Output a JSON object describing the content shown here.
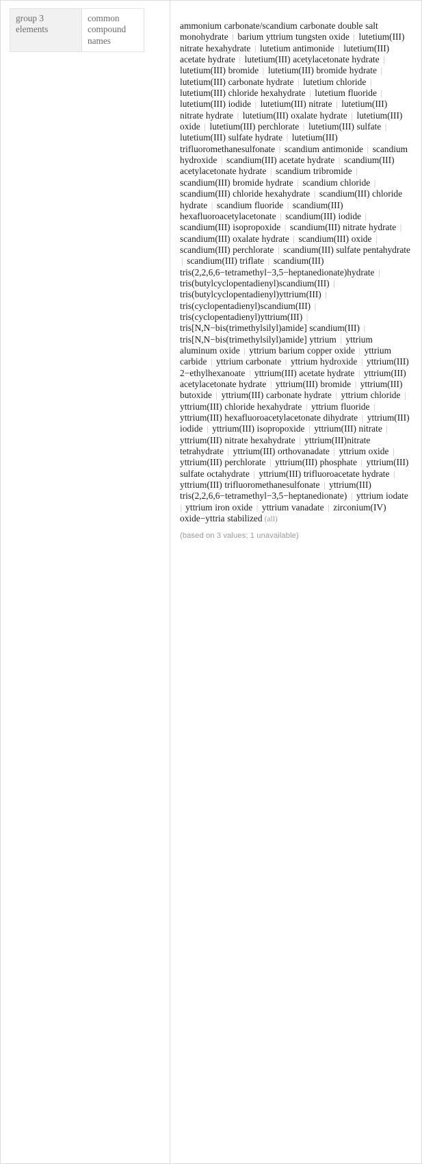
{
  "property_table": {
    "key_label": "group 3 elements",
    "value_label": "common compound names"
  },
  "result": {
    "all_tag": "(all)",
    "basis_note": "(based on 3 values; 1 unavailable)",
    "separator": "|",
    "compounds": [
      "ammonium carbonate/scandium carbonate double salt monohydrate",
      "barium yttrium tungsten oxide",
      "lutetium(III) nitrate hexahydrate",
      "lutetium antimonide",
      "lutetium(III) acetate hydrate",
      "lutetium(III) acetylacetonate hydrate",
      "lutetium(III) bromide",
      "lutetium(III) bromide hydrate",
      "lutetium(III) carbonate hydrate",
      "lutetium chloride",
      "lutetium(III) chloride hexahydrate",
      "lutetium fluoride",
      "lutetium(III) iodide",
      "lutetium(III) nitrate",
      "lutetium(III) nitrate hydrate",
      "lutetium(III) oxalate hydrate",
      "lutetium(III) oxide",
      "lutetium(III) perchlorate",
      "lutetium(III) sulfate",
      "lutetium(III) sulfate hydrate",
      "lutetium(III) trifluoromethanesulfonate",
      "scandium antimonide",
      "scandium hydroxide",
      "scandium(III) acetate hydrate",
      "scandium(III) acetylacetonate hydrate",
      "scandium tribromide",
      "scandium(III) bromide hydrate",
      "scandium chloride",
      "scandium(III) chloride hexahydrate",
      "scandium(III) chloride hydrate",
      "scandium fluoride",
      "scandium(III) hexafluoroacetylacetonate",
      "scandium(III) iodide",
      "scandium(III) isopropoxide",
      "scandium(III) nitrate hydrate",
      "scandium(III) oxalate hydrate",
      "scandium(III) oxide",
      "scandium(III) perchlorate",
      "scandium(III) sulfate pentahydrate",
      "scandium(III) triflate",
      "scandium(III) tris(2,2,6,6−tetramethyl−3,5−heptanedionate)hydrate",
      "tris(butylcyclopentadienyl)scandium(III)",
      "tris(butylcyclopentadienyl)yttrium(III)",
      "tris(cyclopentadienyl)scandium(III)",
      "tris(cyclopentadienyl)yttrium(III)",
      "tris[N,N−bis(trimethylsilyl)amide] scandium(III)",
      "tris[N,N−bis(trimethylsilyl)amide] yttrium",
      "yttrium aluminum oxide",
      "yttrium barium copper oxide",
      "yttrium carbide",
      "yttrium carbonate",
      "yttrium hydroxide",
      "yttrium(III) 2−ethylhexanoate",
      "yttrium(III) acetate hydrate",
      "yttrium(III) acetylacetonate hydrate",
      "yttrium(III) bromide",
      "yttrium(III) butoxide",
      "yttrium(III) carbonate hydrate",
      "yttrium chloride",
      "yttrium(III) chloride hexahydrate",
      "yttrium fluoride",
      "yttrium(III) hexafluoroacetylacetonate dihydrate",
      "yttrium(III) iodide",
      "yttrium(III) isopropoxide",
      "yttrium(III) nitrate",
      "yttrium(III) nitrate hexahydrate",
      "yttrium(III)nitrate tetrahydrate",
      "yttrium(III) orthovanadate",
      "yttrium oxide",
      "yttrium(III) perchlorate",
      "yttrium(III) phosphate",
      "yttrium(III) sulfate octahydrate",
      "yttrium(III) trifluoroacetate hydrate",
      "yttrium(III) trifluoromethanesulfonate",
      "yttrium(III) tris(2,2,6,6−tetramethyl−3,5−heptanedionate)",
      "yttrium iodate",
      "yttrium iron oxide",
      "yttrium vanadate",
      "zirconium(IV) oxide−yttria stabilized"
    ]
  }
}
